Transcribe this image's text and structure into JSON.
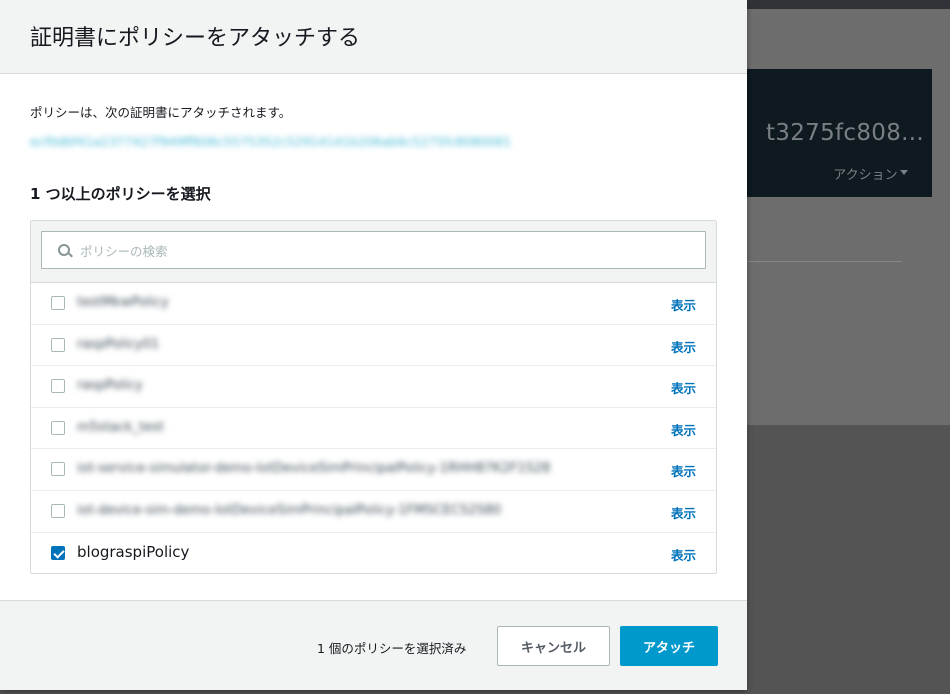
{
  "background": {
    "title": "t3275fc808...",
    "actions_label": "アクション"
  },
  "modal": {
    "title": "証明書にポリシーをアタッチする",
    "intro": "ポリシーは、次の証明書にアタッチされます。",
    "certificate_arn": "ecf0dbf41a2377427f949ff606c5575352c52914141b206ab6c5275fc8080081",
    "section_label": "1 つ以上のポリシーを選択",
    "search": {
      "placeholder": "ポリシーの検索",
      "value": ""
    },
    "policies": [
      {
        "name": "testMkwPolicy",
        "checked": false,
        "view_label": "表示"
      },
      {
        "name": "raspPolicy01",
        "checked": false,
        "view_label": "表示"
      },
      {
        "name": "raspPolicy",
        "checked": false,
        "view_label": "表示"
      },
      {
        "name": "m5stack_test",
        "checked": false,
        "view_label": "表示"
      },
      {
        "name": "iot-service-simulator-demo-IotDeviceSimPrincipalPolicy-1RHH87K2F1S28",
        "checked": false,
        "view_label": "表示"
      },
      {
        "name": "iot-device-sim-demo-IotDeviceSimPrincipalPolicy-1FMSCECS2S80",
        "checked": false,
        "view_label": "表示"
      },
      {
        "name": "blograspiPolicy",
        "checked": true,
        "view_label": "表示"
      }
    ],
    "footer": {
      "selected_count": "1 個のポリシーを選択済み",
      "cancel_label": "キャンセル",
      "attach_label": "アタッチ"
    }
  },
  "colors": {
    "primary_button": "#0099cc",
    "link": "#0073bb",
    "checkbox_checked": "#0073bb"
  }
}
